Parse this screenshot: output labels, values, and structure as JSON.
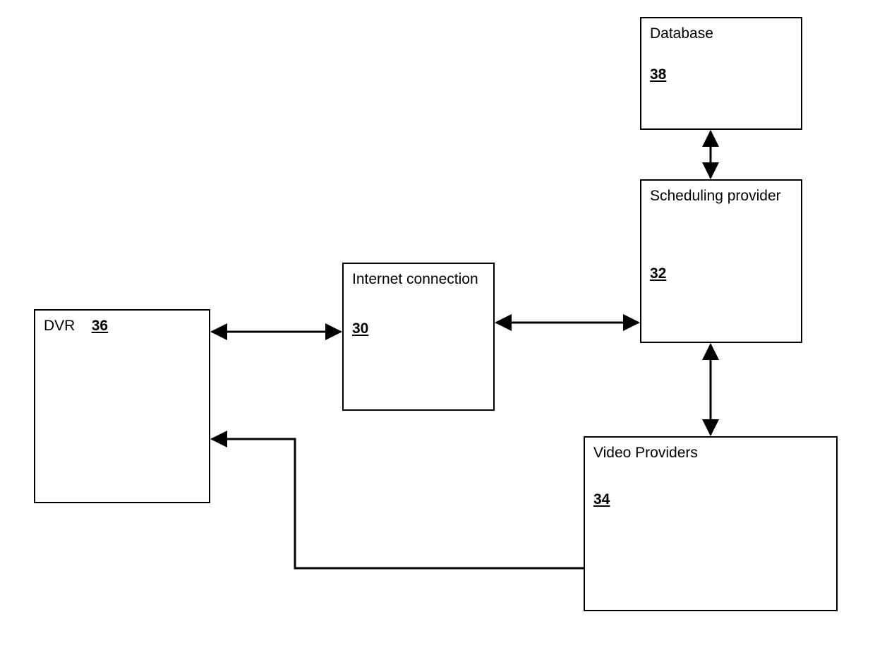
{
  "nodes": {
    "dvr": {
      "label": "DVR",
      "ref": "36"
    },
    "internet": {
      "label": "Internet connection",
      "ref": "30"
    },
    "scheduling": {
      "label": "Scheduling provider",
      "ref": "32"
    },
    "database": {
      "label": "Database",
      "ref": "38"
    },
    "video": {
      "label": "Video Providers",
      "ref": "34"
    }
  },
  "edges": [
    {
      "from": "dvr",
      "to": "internet",
      "type": "bidirectional"
    },
    {
      "from": "internet",
      "to": "scheduling",
      "type": "bidirectional"
    },
    {
      "from": "scheduling",
      "to": "database",
      "type": "bidirectional"
    },
    {
      "from": "scheduling",
      "to": "video",
      "type": "bidirectional"
    },
    {
      "from": "video",
      "to": "dvr",
      "type": "unidirectional"
    }
  ]
}
